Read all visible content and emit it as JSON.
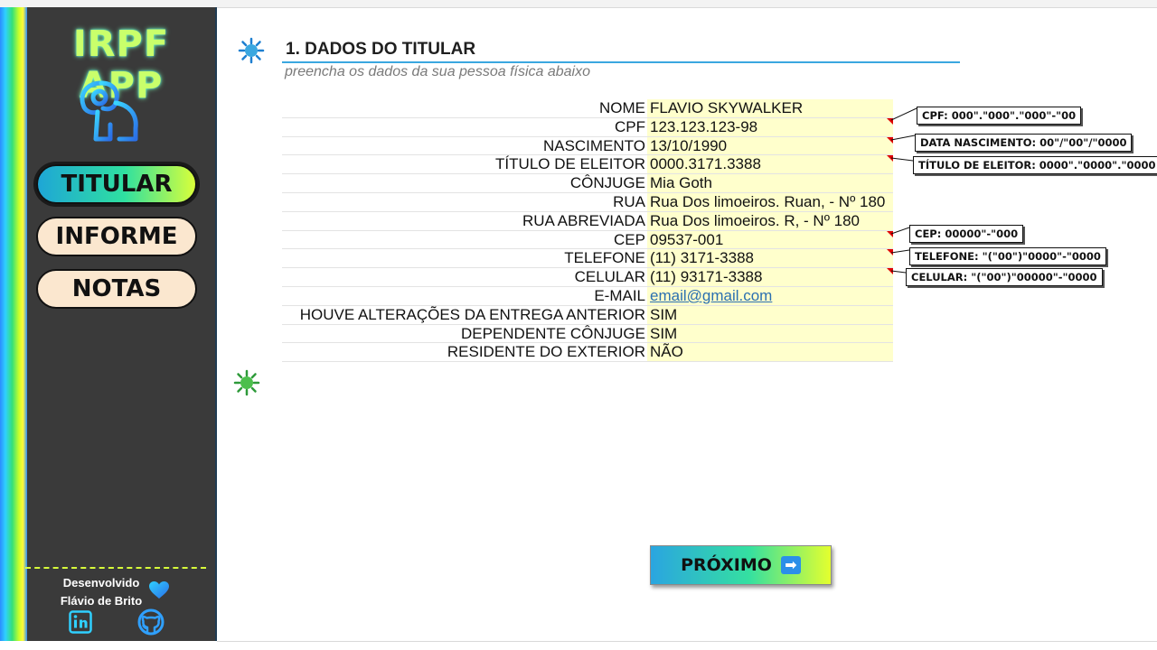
{
  "sidebar": {
    "app_title": "IRPF APP",
    "nav": [
      {
        "label": "TITULAR",
        "active": true
      },
      {
        "label": "INFORME",
        "active": false
      },
      {
        "label": "NOTAS",
        "active": false
      }
    ],
    "developer_line1": "Desenvolvido",
    "developer_line2": "Flávio de Brito",
    "icons": [
      "lion-logo-icon",
      "heart-icon",
      "linkedin-icon",
      "github-icon"
    ]
  },
  "section": {
    "title": "1. DADOS DO TITULAR",
    "subtitle": "preencha os dados da sua pessoa física abaixo"
  },
  "form": {
    "fields": [
      {
        "label": "NOME",
        "value": "FLAVIO SKYWALKER"
      },
      {
        "label": "CPF",
        "value": "123.123.123-98"
      },
      {
        "label": "NASCIMENTO",
        "value": "13/10/1990"
      },
      {
        "label": "TÍTULO DE ELEITOR",
        "value": "0000.3171.3388"
      },
      {
        "label": "CÔNJUGE",
        "value": "Mia Goth"
      },
      {
        "label": "RUA",
        "value": "Rua Dos limoeiros. Ruan, - Nº 180"
      },
      {
        "label": "RUA ABREVIADA",
        "value": "Rua Dos limoeiros. R, - Nº 180"
      },
      {
        "label": "CEP",
        "value": "09537-001"
      },
      {
        "label": "TELEFONE",
        "value": "(11) 3171-3388"
      },
      {
        "label": "CELULAR",
        "value": "(11) 93171-3388"
      },
      {
        "label": "E-MAIL",
        "value": "email@gmail.com"
      },
      {
        "label": "HOUVE ALTERAÇÕES DA ENTREGA ANTERIOR",
        "value": "SIM"
      },
      {
        "label": "DEPENDENTE CÔNJUGE",
        "value": "SIM"
      },
      {
        "label": "RESIDENTE DO EXTERIOR",
        "value": "NÃO"
      }
    ]
  },
  "notes": {
    "cpf": "CPF: 000\".\"000\".\"000\"-\"00",
    "nascimento": "DATA NASCIMENTO: 00\"/\"00\"/\"0000",
    "titulo": "TÍTULO DE ELEITOR: 0000\".\"0000\".\"0000",
    "cep": "CEP: 00000\"-\"000",
    "telefone": "TELEFONE: \"(\"00\")\"0000\"-\"0000",
    "celular": "CELULAR: \"(\"00\")\"00000\"-\"0000"
  },
  "next_button": {
    "label": "PRÓXIMO",
    "icon": "right-arrow-icon"
  },
  "colors": {
    "accent_blue": "#3aa7e0",
    "input_fill": "#ffffcc",
    "sidebar_bg": "#3a3a3a",
    "highlight_green": "#c9ff6b"
  }
}
